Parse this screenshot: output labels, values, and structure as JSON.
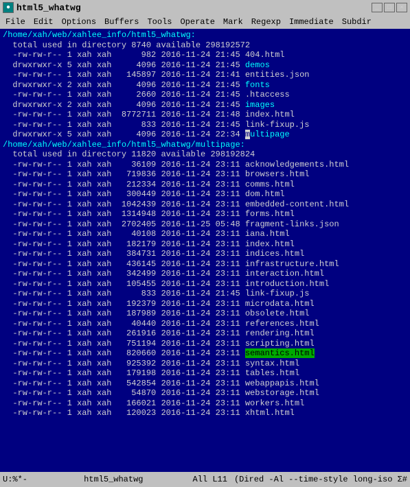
{
  "titleBar": {
    "title": "html5_whatwg",
    "icon": "●",
    "buttons": [
      "_",
      "□",
      "×"
    ]
  },
  "menuBar": {
    "items": [
      "File",
      "Edit",
      "Options",
      "Buffers",
      "Tools",
      "Operate",
      "Mark",
      "Regexp",
      "Immediate",
      "Subdir"
    ]
  },
  "statusBar": {
    "mode": "U:%*-",
    "bufferName": "html5_whatwg",
    "position": "All L11",
    "extra": "(Dired -Al --time-style long-iso Σ#"
  },
  "lines": [
    {
      "text": "/home/xah/web/xahlee_info/html5_whatwg:",
      "color": "cyan"
    },
    {
      "text": "  total used in directory 8740 available 298192572",
      "color": "normal"
    },
    {
      "text": "  -rw-rw-r-- 1 xah xah      982 2016-11-24 21:45 404.html",
      "color": "normal"
    },
    {
      "text": "  drwxrwxr-x 5 xah xah     4096 2016-11-24 21:45 demos",
      "color": "normal",
      "linkWord": "demos",
      "linkColor": "cyan"
    },
    {
      "text": "  -rw-rw-r-- 1 xah xah   145897 2016-11-24 21:41 entities.json",
      "color": "normal"
    },
    {
      "text": "  drwxrwxr-x 2 xah xah     4096 2016-11-24 21:45 fonts",
      "color": "normal",
      "linkWord": "fonts",
      "linkColor": "cyan"
    },
    {
      "text": "  -rw-rw-r-- 1 xah xah     2660 2016-11-24 21:45 .htaccess",
      "color": "normal"
    },
    {
      "text": "  drwxrwxr-x 2 xah xah     4096 2016-11-24 21:45 images",
      "color": "normal",
      "linkWord": "images",
      "linkColor": "cyan"
    },
    {
      "text": "  -rw-rw-r-- 1 xah xah  8772711 2016-11-24 21:48 index.html",
      "color": "normal"
    },
    {
      "text": "  -rw-rw-r-- 1 xah xah      833 2016-11-24 21:45 link-fixup.js",
      "color": "normal"
    },
    {
      "text": "  drwxrwxr-x 5 xah xah     4096 2016-11-24 22:34 multipage",
      "color": "normal",
      "cursor": true,
      "linkWord": "multipage",
      "linkColor": "cyan"
    },
    {
      "text": "",
      "color": "normal"
    },
    {
      "text": "/home/xah/web/xahlee_info/html5_whatwg/multipage:",
      "color": "cyan"
    },
    {
      "text": "  total used in directory 11820 available 298192824",
      "color": "normal"
    },
    {
      "text": "  -rw-rw-r-- 1 xah xah    36109 2016-11-24 23:11 acknowledgements.html",
      "color": "normal"
    },
    {
      "text": "  -rw-rw-r-- 1 xah xah   719836 2016-11-24 23:11 browsers.html",
      "color": "normal"
    },
    {
      "text": "  -rw-rw-r-- 1 xah xah   212334 2016-11-24 23:11 comms.html",
      "color": "normal"
    },
    {
      "text": "  -rw-rw-r-- 1 xah xah   300449 2016-11-24 23:11 dom.html",
      "color": "normal"
    },
    {
      "text": "  -rw-rw-r-- 1 xah xah  1042439 2016-11-24 23:11 embedded-content.html",
      "color": "normal"
    },
    {
      "text": "  -rw-rw-r-- 1 xah xah  1314948 2016-11-24 23:11 forms.html",
      "color": "normal"
    },
    {
      "text": "  -rw-rw-r-- 1 xah xah  2702405 2016-11-25 05:48 fragment-links.json",
      "color": "normal"
    },
    {
      "text": "  -rw-rw-r-- 1 xah xah    40108 2016-11-24 23:11 iana.html",
      "color": "normal"
    },
    {
      "text": "  -rw-rw-r-- 1 xah xah   182179 2016-11-24 23:11 index.html",
      "color": "normal"
    },
    {
      "text": "  -rw-rw-r-- 1 xah xah   384731 2016-11-24 23:11 indices.html",
      "color": "normal"
    },
    {
      "text": "  -rw-rw-r-- 1 xah xah   436145 2016-11-24 23:11 infrastructure.html",
      "color": "normal"
    },
    {
      "text": "  -rw-rw-r-- 1 xah xah   342499 2016-11-24 23:11 interaction.html",
      "color": "normal"
    },
    {
      "text": "  -rw-rw-r-- 1 xah xah   105455 2016-11-24 23:11 introduction.html",
      "color": "normal"
    },
    {
      "text": "  -rw-rw-r-- 1 xah xah      833 2016-11-24 21:45 link-fixup.js",
      "color": "normal"
    },
    {
      "text": "  -rw-rw-r-- 1 xah xah   192379 2016-11-24 23:11 microdata.html",
      "color": "normal"
    },
    {
      "text": "  -rw-rw-r-- 1 xah xah   187989 2016-11-24 23:11 obsolete.html",
      "color": "normal"
    },
    {
      "text": "  -rw-rw-r-- 1 xah xah    40440 2016-11-24 23:11 references.html",
      "color": "normal"
    },
    {
      "text": "  -rw-rw-r-- 1 xah xah   261916 2016-11-24 23:11 rendering.html",
      "color": "normal"
    },
    {
      "text": "  -rw-rw-r-- 1 xah xah   751194 2016-11-24 23:11 scripting.html",
      "color": "normal"
    },
    {
      "text": "  -rw-rw-r-- 1 xah xah   820660 2016-11-24 23:11 semantics.html",
      "color": "normal",
      "highlight": "semantics.html"
    },
    {
      "text": "  -rw-rw-r-- 1 xah xah   925392 2016-11-24 23:11 syntax.html",
      "color": "normal"
    },
    {
      "text": "  -rw-rw-r-- 1 xah xah   179198 2016-11-24 23:11 tables.html",
      "color": "normal"
    },
    {
      "text": "  -rw-rw-r-- 1 xah xah   542854 2016-11-24 23:11 webappapis.html",
      "color": "normal"
    },
    {
      "text": "  -rw-rw-r-- 1 xah xah    54870 2016-11-24 23:11 webstorage.html",
      "color": "normal"
    },
    {
      "text": "  -rw-rw-r-- 1 xah xah   166021 2016-11-24 23:11 workers.html",
      "color": "normal"
    },
    {
      "text": "  -rw-rw-r-- 1 xah xah   120023 2016-11-24 23:11 xhtml.html",
      "color": "normal"
    }
  ]
}
